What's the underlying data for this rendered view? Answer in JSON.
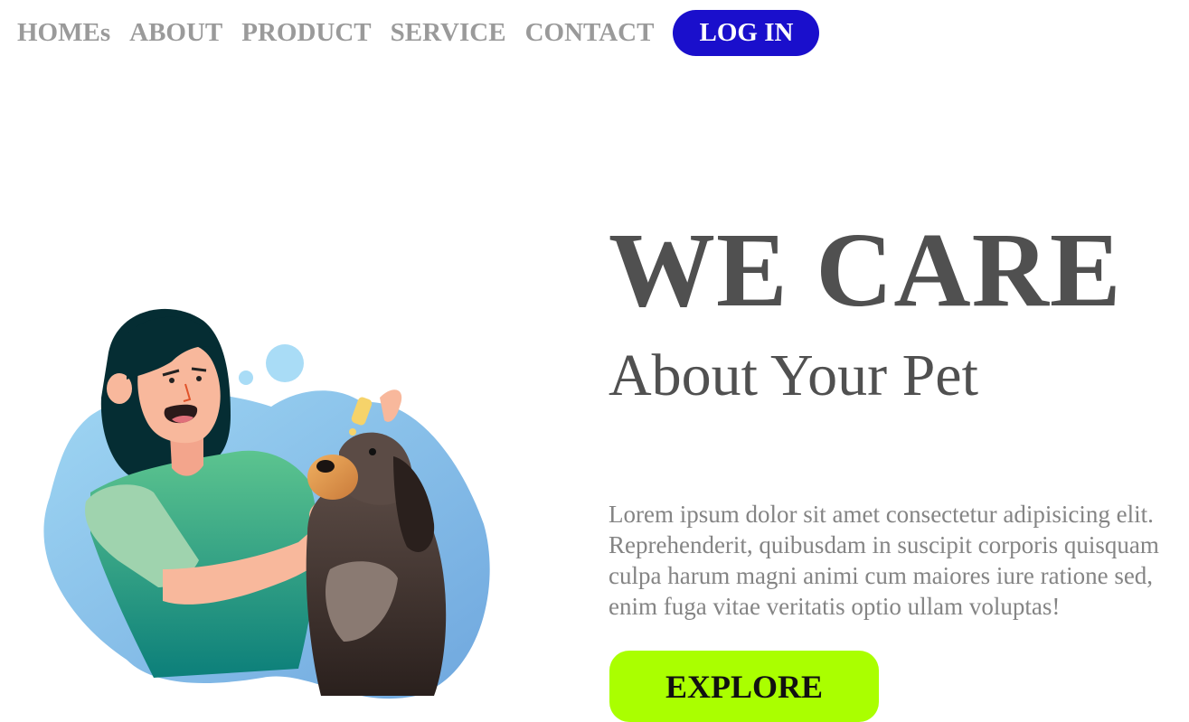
{
  "nav": {
    "items": [
      {
        "label": "HOMEs"
      },
      {
        "label": "ABOUT"
      },
      {
        "label": "PRODUCT"
      },
      {
        "label": "SERVICE"
      },
      {
        "label": "CONTACT"
      }
    ],
    "login_label": "LOG IN"
  },
  "hero": {
    "title": "WE CARE",
    "subtitle": "About Your Pet",
    "body": "Lorem ipsum dolor sit amet consectetur adipisicing elit. Reprehenderit, quibusdam in suscipit corporis quisquam culpa harum magni animi cum maiores iure ratione sed, enim fuga vitae veritatis optio ullam voluptas!",
    "explore_label": "EXPLORE"
  },
  "colors": {
    "nav_text": "#9a9a9a",
    "login_bg": "#1a0fcc",
    "heading_text": "#505050",
    "body_text": "#848484",
    "explore_bg": "#aaff00"
  },
  "illustration": {
    "name": "woman-giving-dog-ear-drops"
  }
}
